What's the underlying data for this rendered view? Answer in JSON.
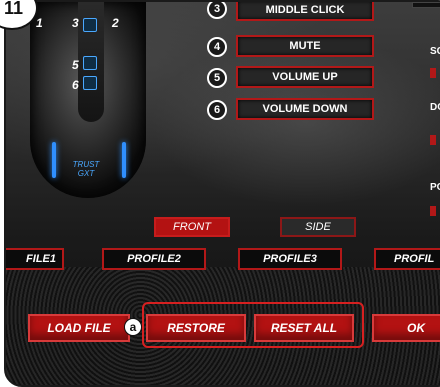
{
  "step_badge": "11",
  "mouse": {
    "button_numbers": [
      "1",
      "3",
      "2",
      "5",
      "6"
    ],
    "logo_text": "TRUST GXT"
  },
  "assignments": [
    {
      "number": "3",
      "label": "MIDDLE CLICK"
    },
    {
      "number": "4",
      "label": "MUTE"
    },
    {
      "number": "5",
      "label": "VOLUME UP"
    },
    {
      "number": "6",
      "label": "VOLUME DOWN"
    }
  ],
  "side_panel": {
    "labels": [
      "SC",
      "DO",
      "PO"
    ]
  },
  "view_toggle": {
    "front_label": "FRONT",
    "side_label": "SIDE",
    "selected": "FRONT"
  },
  "profiles": [
    "FILE1",
    "PROFILE2",
    "PROFILE3",
    "PROFIL"
  ],
  "actions": {
    "load_file": "LOAD FILE",
    "restore": "RESTORE",
    "reset_all": "RESET ALL",
    "ok": "OK"
  },
  "callout_marker": "a",
  "colors": {
    "accent_red": "#b31212",
    "border_red": "#d62020",
    "mouse_blue": "#2f8fff"
  }
}
